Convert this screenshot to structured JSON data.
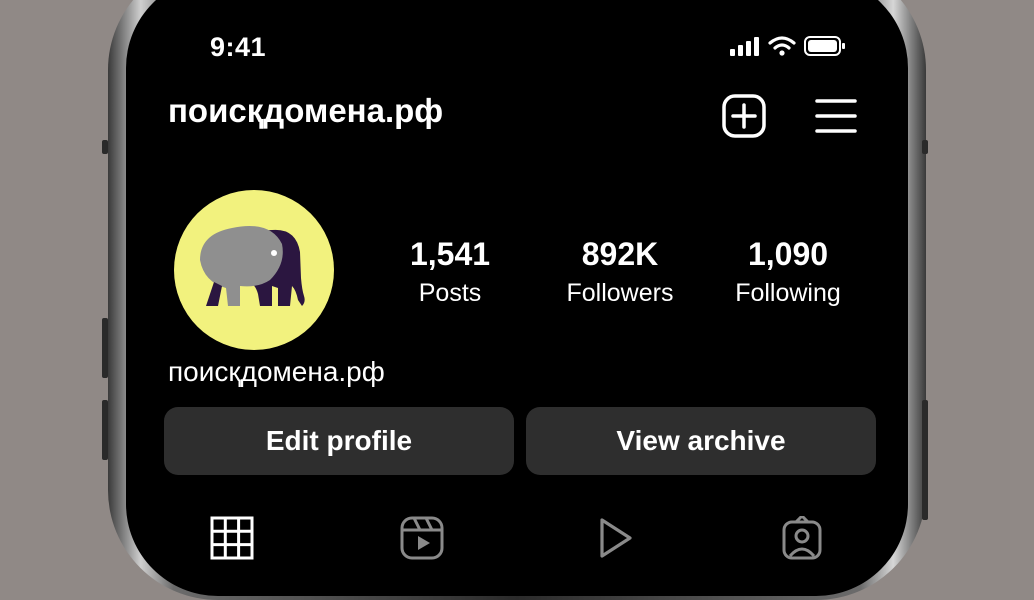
{
  "status_bar": {
    "time": "9:41"
  },
  "header": {
    "title": "поисқдомена.рф"
  },
  "profile": {
    "username": "поисқдомена.рф",
    "stats": [
      {
        "value": "1,541",
        "label": "Posts"
      },
      {
        "value": "892K",
        "label": "Followers"
      },
      {
        "value": "1,090",
        "label": "Following"
      }
    ]
  },
  "actions": {
    "edit_label": "Edit profile",
    "archive_label": "View archive"
  },
  "tabs": [
    "grid-icon",
    "reels-icon",
    "play-icon",
    "tagged-icon"
  ],
  "colors": {
    "avatar_bg": "#f2f27e",
    "elephant_body": "#8f8f8f",
    "elephant_shadow": "#2b1640",
    "button_bg": "#2e2e2e",
    "screen_bg": "#000000"
  }
}
